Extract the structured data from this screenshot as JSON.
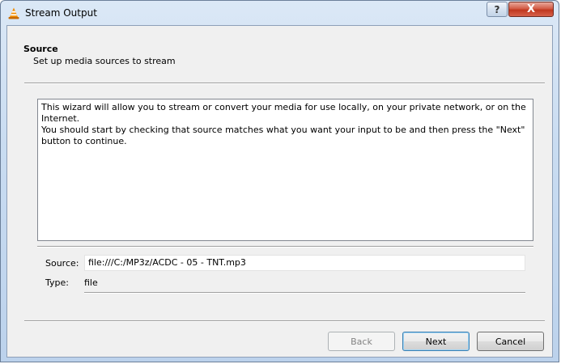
{
  "window": {
    "title": "Stream Output",
    "help_label": "?",
    "close_label": "X"
  },
  "header": {
    "title": "Source",
    "subtitle": "Set up media sources to stream"
  },
  "description": {
    "line1": "This wizard will allow you to stream or convert your media for use locally, on your private network, or on the Internet.",
    "line2": "You should start by checking that source matches what you want your input to be and then press the \"Next\" button to continue."
  },
  "source": {
    "label": "Source:",
    "value": "file:///C:/MP3z/ACDC - 05 - TNT.mp3"
  },
  "type": {
    "label": "Type:",
    "value": "file"
  },
  "buttons": {
    "back": "Back",
    "next": "Next",
    "cancel": "Cancel"
  },
  "colors": {
    "vlc_orange": "#f08c00",
    "close_red": "#c7402a",
    "default_button_border": "#3c7fb1"
  },
  "icons": {
    "app": "vlc-cone-icon",
    "help": "help-icon",
    "close": "close-icon"
  }
}
